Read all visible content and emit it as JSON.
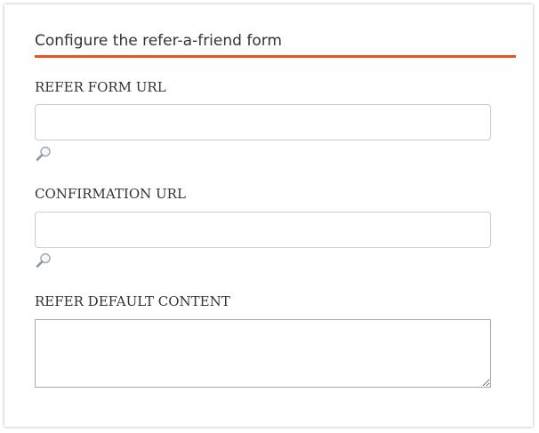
{
  "form": {
    "title": "Configure the refer-a-friend form",
    "accent_color": "#e8541e",
    "fields": {
      "refer_form_url": {
        "label": "REFER FORM URL",
        "value": "",
        "icon": "magnifier-lookup-icon"
      },
      "confirmation_url": {
        "label": "CONFIRMATION URL",
        "value": "",
        "icon": "magnifier-lookup-icon"
      },
      "refer_default_content": {
        "label": "REFER DEFAULT CONTENT",
        "value": ""
      }
    }
  }
}
